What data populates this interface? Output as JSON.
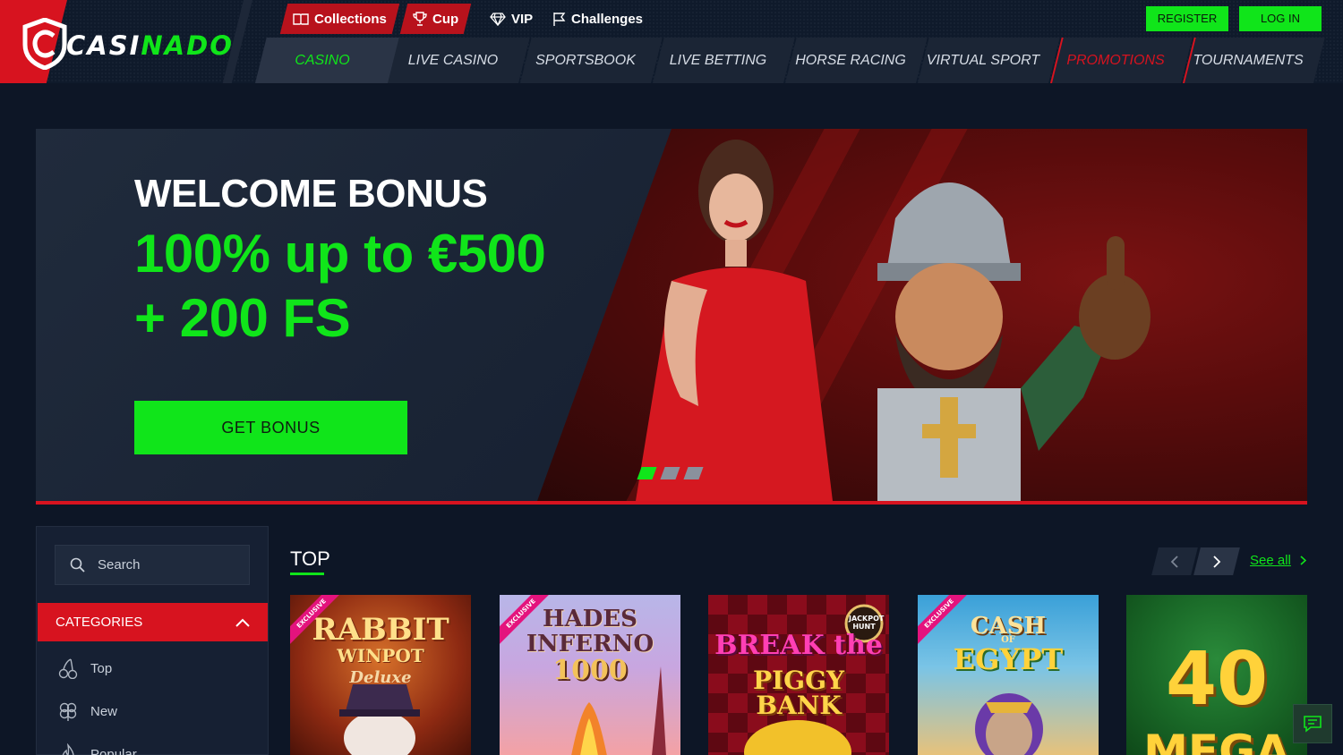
{
  "brand": {
    "logo_text": "CASINADO"
  },
  "topnav": {
    "items": [
      {
        "label": "Collections",
        "icon": "book-icon"
      },
      {
        "label": "Cup",
        "icon": "trophy-icon"
      },
      {
        "label": "VIP",
        "icon": "diamond-icon"
      },
      {
        "label": "Challenges",
        "icon": "flag-icon"
      }
    ]
  },
  "auth": {
    "register_label": "REGISTER",
    "login_label": "LOG IN"
  },
  "mainnav": {
    "items": [
      {
        "label": "CASINO",
        "active": true
      },
      {
        "label": "LIVE CASINO"
      },
      {
        "label": "SPORTSBOOK"
      },
      {
        "label": "LIVE BETTING"
      },
      {
        "label": "HORSE RACING"
      },
      {
        "label": "VIRTUAL SPORT"
      },
      {
        "label": "PROMOTIONS",
        "highlight": true
      },
      {
        "label": "TOURNAMENTS"
      }
    ]
  },
  "hero": {
    "title": "WELCOME BONUS",
    "bonus_text": "100% up to €500 + 200 FS",
    "cta_label": "GET BONUS",
    "slides_count": 3,
    "active_slide": 1
  },
  "sidebar": {
    "search_placeholder": "Search",
    "categories_label": "CATEGORIES",
    "categories": [
      {
        "label": "Top",
        "icon": "cherries-icon"
      },
      {
        "label": "New",
        "icon": "clover-icon"
      },
      {
        "label": "Popular",
        "icon": "fire-icon"
      }
    ]
  },
  "games_section": {
    "title": "TOP",
    "see_all_label": "See all",
    "games": [
      {
        "title_line1": "RABBIT",
        "title_line2": "WINPOT",
        "title_line3": "Deluxe",
        "exclusive": true
      },
      {
        "title_line1": "HADES",
        "title_line2": "INFERNO",
        "title_line3": "1000",
        "exclusive": true
      },
      {
        "title_line1": "BREAK the",
        "title_line2": "PIGGY BANK",
        "badge": "JACKPOT HUNT"
      },
      {
        "title_line1": "CASH",
        "title_line2": "EGYPT",
        "title_line_of": "OF",
        "exclusive": true
      },
      {
        "title_line1": "40",
        "title_line2": "MEGA"
      }
    ],
    "exclusive_label": "EXCLUSIVE"
  },
  "colors": {
    "accent_green": "#10e51a",
    "accent_red": "#d7131f",
    "background": "#0d1626"
  }
}
